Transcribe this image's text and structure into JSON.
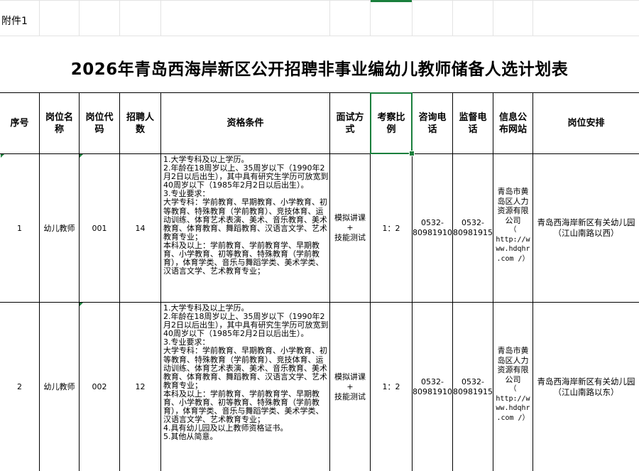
{
  "sheet": {
    "attachment_label": "附件1",
    "title": "2026年青岛西海岸新区公开招聘非事业编幼儿教师储备人选计划表"
  },
  "headers": {
    "seq": "序号",
    "position_name": "岗位名称",
    "position_code": "岗位代码",
    "recruit_count": "招聘人数",
    "qualifications": "资格条件",
    "interview_method": "面试方式",
    "assessment_ratio": "考察比例",
    "consult_phone": "咨询电话",
    "supervise_phone": "监督电话",
    "info_site": "信息公布网站",
    "assignment": "岗位安排"
  },
  "rows": [
    {
      "seq": "1",
      "position_name": "幼儿教师",
      "position_code": "001",
      "recruit_count": "14",
      "qualifications": "1.大学专科及以上学历。\n2.年龄在18周岁以上、35周岁以下（1990年2月2日以后出生），其中具有研究生学历可放宽到40周岁以下（1985年2月2日以后出生）。\n3.专业要求：\n大学专科：学前教育、早期教育、小学教育、初等教育、特殊教育（学前教育）、竞技体育、运动训练、体育艺术表演、美术、音乐教育、美术教育、体育教育、舞蹈教育、汉语言文学、艺术教育专业；\n本科及以上：学前教育、学前教育学、早期教育、小学教育、初等教育、特殊教育（学前教育），体育学类、音乐与舞蹈学类、美术学类、汉语言文学、艺术教育专业；",
      "interview_method": "模拟讲课\n+\n技能测试",
      "assessment_ratio": "1：2",
      "consult_phone": "0532-\n80981910",
      "supervise_phone": "0532-\n80981915",
      "info_site_org": "青岛市黄岛区人力资源有限公司",
      "info_site_url": "（\nhttp://w\nww.hdqhr\n.com /）",
      "assignment": "青岛西海岸新区有关幼儿园（江山南路以西）"
    },
    {
      "seq": "2",
      "position_name": "幼儿教师",
      "position_code": "002",
      "recruit_count": "12",
      "qualifications": "1.大学专科及以上学历。\n2.年龄在18周岁以上、35周岁以下（1990年2月2日以后出生），其中具有研究生学历可放宽到40周岁以下（1985年2月2日以后出生）。\n3.专业要求：\n大学专科：学前教育、早期教育、小学教育、初等教育、特殊教育（学前教育）、竞技体育、运动训练、体育艺术表演、美术、音乐教育、美术教育、体育教育、舞蹈教育、汉语言文学、艺术教育专业；\n本科及以上：学前教育、学前教育学、早期教育、小学教育、初等教育、特殊教育（学前教育），体育学类、音乐与舞蹈学类、美术学类、汉语言文学、艺术教育专业；\n4.具有幼儿园及以上教师资格证书。\n5.其他从简意。",
      "interview_method": "模拟讲课\n+\n技能测试",
      "assessment_ratio": "1：2",
      "consult_phone": "0532-\n80981910",
      "supervise_phone": "0532-\n80981915",
      "info_site_org": "青岛市黄岛区人力资源有限公司",
      "info_site_url": "（\nhttp://w\nww.hdqhr\n.com /）",
      "assignment": "青岛西海岸新区有关幼儿园（江山南路以东）"
    }
  ],
  "colors": {
    "grid": "#e3e3e3",
    "border": "#000000",
    "selection": "#1a7f3c"
  }
}
